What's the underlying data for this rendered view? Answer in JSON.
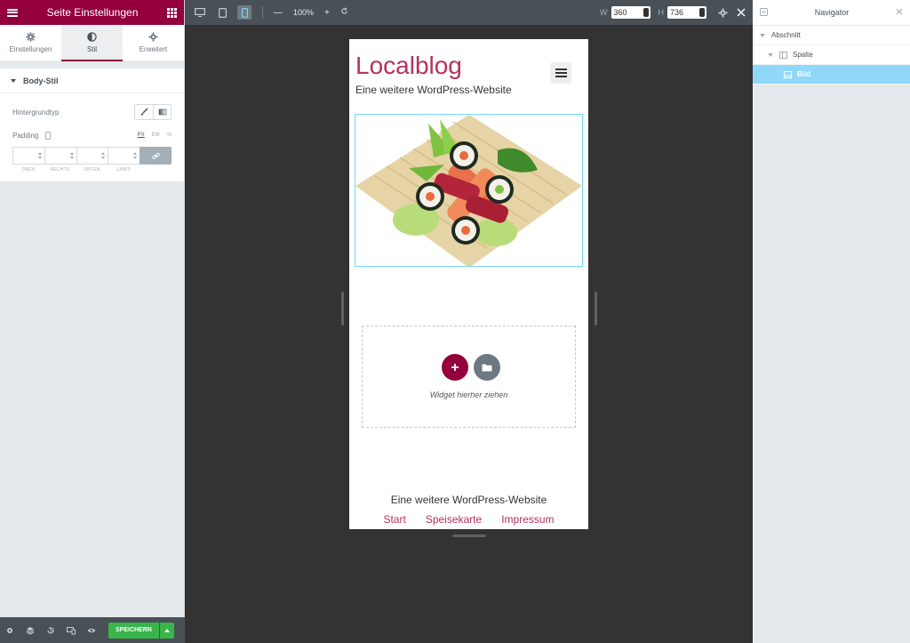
{
  "left_panel": {
    "title": "Seite Einstellungen",
    "tabs": [
      {
        "label": "Einstellungen",
        "icon": "gear-icon"
      },
      {
        "label": "Stil",
        "icon": "half-circle-icon"
      },
      {
        "label": "Erweitert",
        "icon": "cog-icon"
      }
    ],
    "active_tab": "Stil",
    "section_title": "Body-Stil",
    "background_type_label": "Hintergrundtyp",
    "padding_label": "Padding",
    "units": [
      "PX",
      "EM",
      "%"
    ],
    "padding_fields": {
      "top": "OBEN",
      "right": "RECHTS",
      "bottom": "UNTEN",
      "left": "LINKS"
    },
    "save_label": "SPEICHERN"
  },
  "topbar": {
    "zoom": "100%",
    "width_label": "W",
    "width_value": "360",
    "height_label": "H",
    "height_value": "736"
  },
  "preview": {
    "site_title": "Localblog",
    "site_tagline": "Eine weitere WordPress-Website",
    "drop_text": "Widget hierher ziehen",
    "footer_tagline": "Eine weitere WordPress-Website",
    "footer_nav": [
      "Start",
      "Speisekarte",
      "Impressum"
    ]
  },
  "navigator": {
    "title": "Navigator",
    "items": [
      {
        "label": "Abschnitt"
      },
      {
        "label": "Spalte"
      },
      {
        "label": "Bild"
      }
    ]
  },
  "colors": {
    "brand": "#93003c",
    "accent_link": "#b5325c",
    "save_green": "#39b54a",
    "selection_blue": "#90d8f9"
  }
}
